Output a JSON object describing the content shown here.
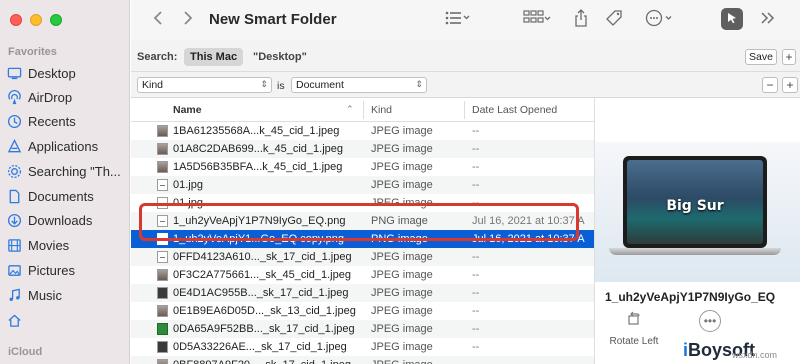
{
  "window": {
    "title": "New Smart Folder"
  },
  "sidebar": {
    "favorites_label": "Favorites",
    "icloud_label": "iCloud",
    "items": [
      {
        "label": "Desktop",
        "icon": "desktop-icon"
      },
      {
        "label": "AirDrop",
        "icon": "airdrop-icon"
      },
      {
        "label": "Recents",
        "icon": "clock-icon"
      },
      {
        "label": "Applications",
        "icon": "applications-icon"
      },
      {
        "label": "Searching \"Th...",
        "icon": "gear-icon"
      },
      {
        "label": "Documents",
        "icon": "document-icon"
      },
      {
        "label": "Downloads",
        "icon": "download-icon"
      },
      {
        "label": "Movies",
        "icon": "film-icon"
      },
      {
        "label": "Pictures",
        "icon": "picture-icon"
      },
      {
        "label": "Music",
        "icon": "music-icon"
      },
      {
        "label": "",
        "icon": "home-icon"
      }
    ]
  },
  "search": {
    "label": "Search:",
    "scope_selected": "This Mac",
    "scope_other": "\"Desktop\"",
    "save_label": "Save",
    "plus_label": "+"
  },
  "criteria": {
    "attribute": "Kind",
    "operator": "is",
    "value": "Document",
    "remove_label": "−",
    "add_label": "+"
  },
  "columns": {
    "name": "Name",
    "kind": "Kind",
    "date": "Date Last Opened"
  },
  "files": [
    {
      "name": "1BA61235568A...k_45_cid_1.jpeg",
      "kind": "JPEG image",
      "date": "--",
      "thumb": "img"
    },
    {
      "name": "01A8C2DAB699...k_45_cid_1.jpeg",
      "kind": "JPEG image",
      "date": "--",
      "thumb": "img"
    },
    {
      "name": "1A5D56B35BFA...k_45_cid_1.jpeg",
      "kind": "JPEG image",
      "date": "--",
      "thumb": "img"
    },
    {
      "name": "01.jpg",
      "kind": "JPEG image",
      "date": "--",
      "thumb": "png"
    },
    {
      "name": "01.jpg",
      "kind": "JPEG image",
      "date": "--",
      "thumb": "png"
    },
    {
      "name": "1_uh2yVeApjY1P7N9IyGo_EQ.png",
      "kind": "PNG image",
      "date": "Jul 16, 2021 at 10:37 A",
      "thumb": "png"
    },
    {
      "name": "1_uh2yVeApjY1...Go_EQ copy.png",
      "kind": "PNG image",
      "date": "Jul 16, 2021 at 10:37 A",
      "thumb": "png",
      "selected": true
    },
    {
      "name": "0FFD4123A610..._sk_17_cid_1.jpeg",
      "kind": "JPEG image",
      "date": "--",
      "thumb": "png"
    },
    {
      "name": "0F3C2A775661..._sk_45_cid_1.jpeg",
      "kind": "JPEG image",
      "date": "--",
      "thumb": "img"
    },
    {
      "name": "0E4D1AC955B..._sk_17_cid_1.jpeg",
      "kind": "JPEG image",
      "date": "--",
      "thumb": "dark"
    },
    {
      "name": "0E1B9EA6D05D..._sk_13_cid_1.jpeg",
      "kind": "JPEG image",
      "date": "--",
      "thumb": "img"
    },
    {
      "name": "0DA65A9F52BB..._sk_17_cid_1.jpeg",
      "kind": "JPEG image",
      "date": "--",
      "thumb": "green"
    },
    {
      "name": "0D5A33226AE..._sk_17_cid_1.jpeg",
      "kind": "JPEG image",
      "date": "--",
      "thumb": "dark"
    },
    {
      "name": "0BF8897A9F20..._sk_17_cid_1.jpeg",
      "kind": "JPEG image",
      "date": "--",
      "thumb": "img"
    }
  ],
  "preview": {
    "screen_text": "Big Sur",
    "file_name": "1_uh2yVeApjY1P7N9IyGo_EQ",
    "rotate_label": "Rotate Left"
  },
  "branding": {
    "logo_prefix": "i",
    "logo_text": "Boysoft",
    "watermark": "wsxdn.com"
  }
}
